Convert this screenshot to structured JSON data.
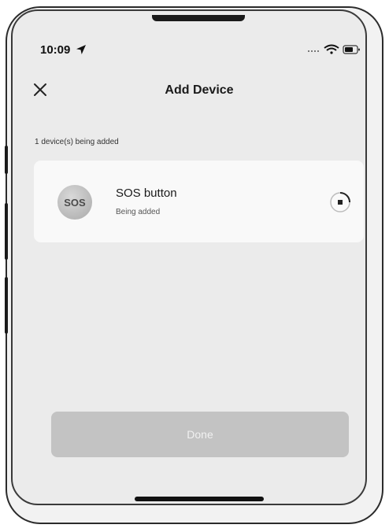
{
  "status_bar": {
    "time": "10:09"
  },
  "header": {
    "title": "Add Device",
    "close_icon": "close-icon"
  },
  "progress": {
    "count_text": "1 device(s) being added"
  },
  "device": {
    "avatar_text": "SOS",
    "name": "SOS button",
    "status": "Being added"
  },
  "actions": {
    "done_label": "Done"
  }
}
